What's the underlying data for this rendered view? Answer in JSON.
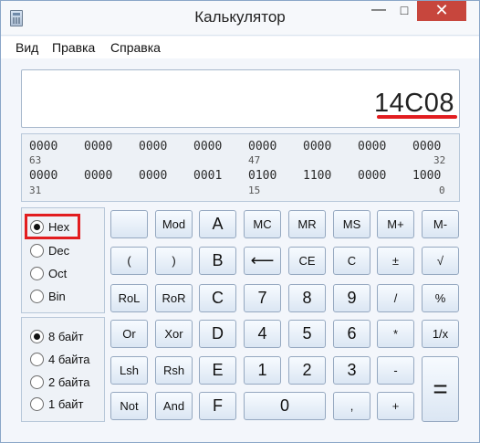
{
  "window": {
    "title": "Калькулятор"
  },
  "titlebar": {
    "minimize": "—",
    "maximize": "□",
    "close": "✕"
  },
  "menu": [
    "Вид",
    "Правка",
    "Справка"
  ],
  "display": {
    "value": "14C08"
  },
  "bits": {
    "row1": [
      "0000",
      "0000",
      "0000",
      "0000",
      "0000",
      "0000",
      "0000",
      "0000"
    ],
    "row1_positions": [
      "63",
      "47",
      "32"
    ],
    "row2": [
      "0000",
      "0000",
      "0000",
      "0001",
      "0100",
      "1100",
      "0000",
      "1000"
    ],
    "row2_positions": [
      "31",
      "15",
      "0"
    ]
  },
  "number_system": {
    "options": [
      "Hex",
      "Dec",
      "Oct",
      "Bin"
    ],
    "selected": "Hex"
  },
  "word_size": {
    "options": [
      "8 байт",
      "4 байта",
      "2 байта",
      "1 байт"
    ],
    "selected": "8 байт"
  },
  "keys": {
    "blank": "",
    "mod": "Mod",
    "a": "A",
    "mc": "MC",
    "mr": "MR",
    "ms": "MS",
    "mplus": "M+",
    "mminus": "M-",
    "lparen": "(",
    "rparen": ")",
    "b": "B",
    "backspace": "⟵",
    "ce": "CE",
    "c": "C",
    "plusminus": "±",
    "sqrt": "√",
    "rol": "RoL",
    "ror": "RoR",
    "c_hex": "C",
    "seven": "7",
    "eight": "8",
    "nine": "9",
    "divide": "/",
    "percent": "%",
    "or": "Or",
    "xor": "Xor",
    "d": "D",
    "four": "4",
    "five": "5",
    "six": "6",
    "multiply": "*",
    "reciprocal": "1/x",
    "lsh": "Lsh",
    "rsh": "Rsh",
    "e": "E",
    "one": "1",
    "two": "2",
    "three": "3",
    "minus": "-",
    "equals": "=",
    "not": "Not",
    "and": "And",
    "f": "F",
    "zero": "0",
    "decimal": ",",
    "plus": "+"
  }
}
